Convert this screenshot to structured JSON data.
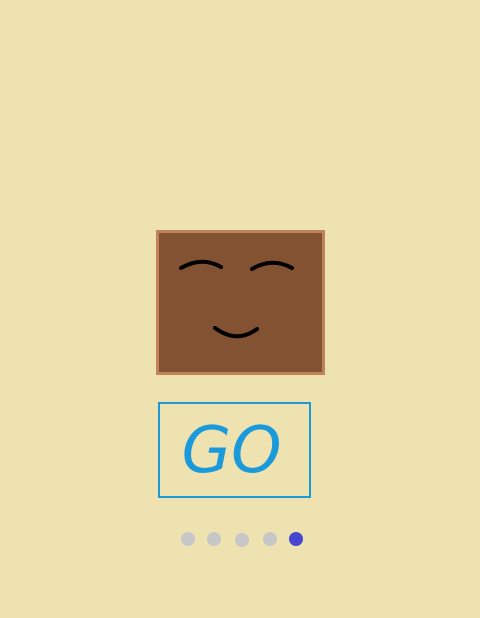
{
  "game": {
    "button": {
      "label": "GO"
    },
    "pager": {
      "total": 5,
      "active": 5
    },
    "colors": {
      "background": "#EEE2B0",
      "card_fill": "#835233",
      "card_border": "#C0825A",
      "face_lines": "#000000",
      "button": "#1A9ADB",
      "dot_inactive": "#C7C7C7",
      "dot_active": "#4646D0"
    },
    "icons": {
      "face": "smiling-face-icon"
    }
  }
}
